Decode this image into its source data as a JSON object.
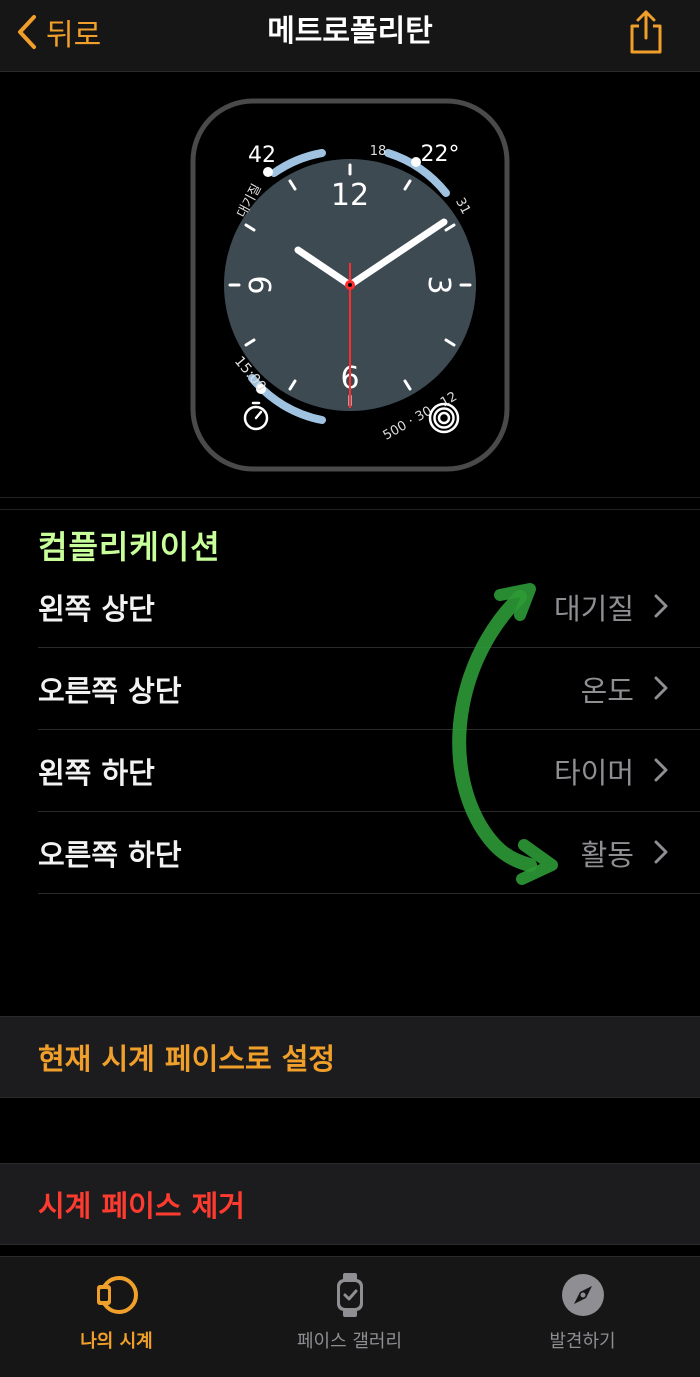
{
  "nav": {
    "back_label": "뒤로",
    "title": "메트로폴리탄"
  },
  "watch_face": {
    "top_left_value": "42",
    "top_left_label": "대기질",
    "top_right_min": "18",
    "top_right_temp": "22°",
    "top_right_max": "31",
    "bottom_left_time": "15:00",
    "bottom_right_ring": "500 · 30 · 12",
    "numerals": [
      "12",
      "3",
      "6",
      "9"
    ]
  },
  "complications": {
    "header": "컴플리케이션",
    "items": [
      {
        "label": "왼쪽 상단",
        "value": "대기질"
      },
      {
        "label": "오른쪽 상단",
        "value": "온도"
      },
      {
        "label": "왼쪽 하단",
        "value": "타이머"
      },
      {
        "label": "오른쪽 하단",
        "value": "활동"
      }
    ]
  },
  "actions": {
    "set_current": "현재 시계 페이스로 설정",
    "remove": "시계 페이스 제거"
  },
  "tabs": [
    {
      "label": "나의 시계",
      "icon": "watch-icon",
      "active": true
    },
    {
      "label": "페이스 갤러리",
      "icon": "face-gallery-icon",
      "active": false
    },
    {
      "label": "발견하기",
      "icon": "compass-icon",
      "active": false
    }
  ],
  "colors": {
    "accent": "#f0a02a",
    "destructive": "#ff3b30",
    "secondary_text": "#8e8e93",
    "dial": "#3d4a52",
    "highlight_green": "#3cc83c"
  }
}
